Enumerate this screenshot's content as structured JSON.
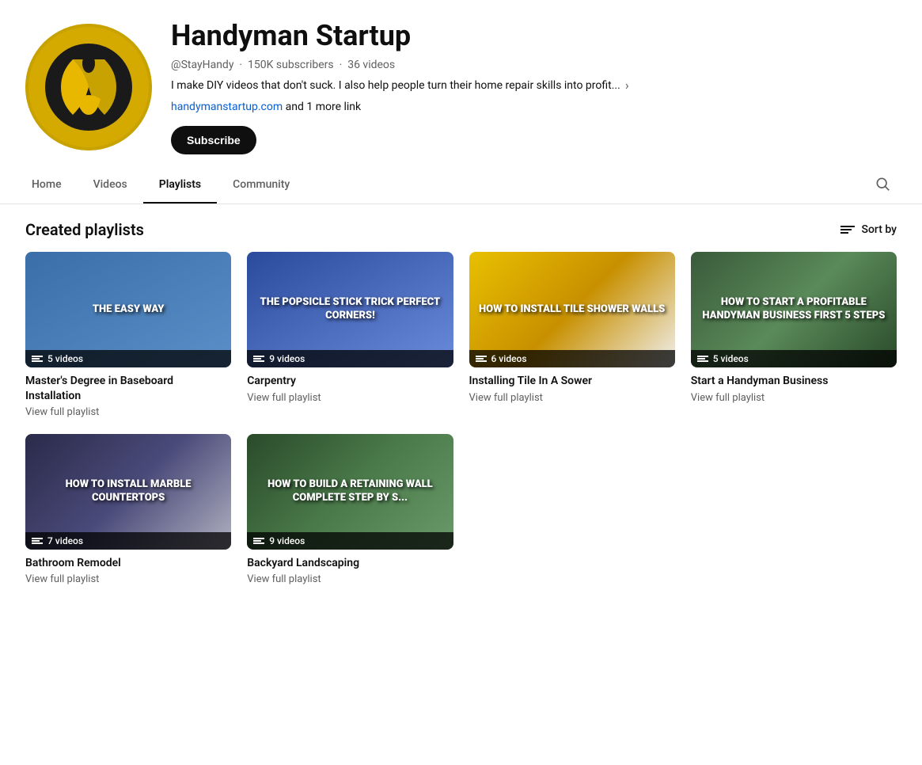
{
  "channel": {
    "name": "Handyman Startup",
    "handle": "@StayHandy",
    "subscribers": "150K subscribers",
    "video_count": "36 videos",
    "description": "I make DIY videos that don't suck. I also help people turn their home repair skills into profit...",
    "website_text": "handymanstartup.com",
    "website_more": "and 1 more link",
    "subscribe_label": "Subscribe"
  },
  "nav": {
    "tabs": [
      {
        "label": "Home",
        "active": false
      },
      {
        "label": "Videos",
        "active": false
      },
      {
        "label": "Playlists",
        "active": true
      },
      {
        "label": "Community",
        "active": false
      }
    ],
    "search_icon": "search"
  },
  "section": {
    "title": "Created playlists",
    "sort_label": "Sort by"
  },
  "playlists": [
    {
      "id": "baseboard",
      "title": "Master's Degree in Baseboard Installation",
      "video_count": "5 videos",
      "view_link": "View full playlist",
      "thumb_text": "THE EASY WAY",
      "thumb_class": "t1"
    },
    {
      "id": "carpentry",
      "title": "Carpentry",
      "video_count": "9 videos",
      "view_link": "View full playlist",
      "thumb_text": "THE POPSICLE STICK TRICK Perfect corners!",
      "thumb_class": "t2"
    },
    {
      "id": "tile",
      "title": "Installing Tile In A Sower",
      "video_count": "6 videos",
      "view_link": "View full playlist",
      "thumb_text": "HOW TO INSTALL TILE Shower Walls",
      "thumb_class": "t3"
    },
    {
      "id": "handyman",
      "title": "Start a Handyman Business",
      "video_count": "5 videos",
      "view_link": "View full playlist",
      "thumb_text": "How to Start a Profitable Handyman Business First 5 Steps",
      "thumb_class": "t4"
    },
    {
      "id": "bathroom",
      "title": "Bathroom Remodel",
      "video_count": "7 videos",
      "view_link": "View full playlist",
      "thumb_text": "HOW TO INSTALL MARBLE COUNTERTOPS",
      "thumb_class": "t5"
    },
    {
      "id": "backyard",
      "title": "Backyard Landscaping",
      "video_count": "9 videos",
      "view_link": "View full playlist",
      "thumb_text": "How to Build a RETAINING WALL Complete Step By S...",
      "thumb_class": "t6"
    }
  ]
}
